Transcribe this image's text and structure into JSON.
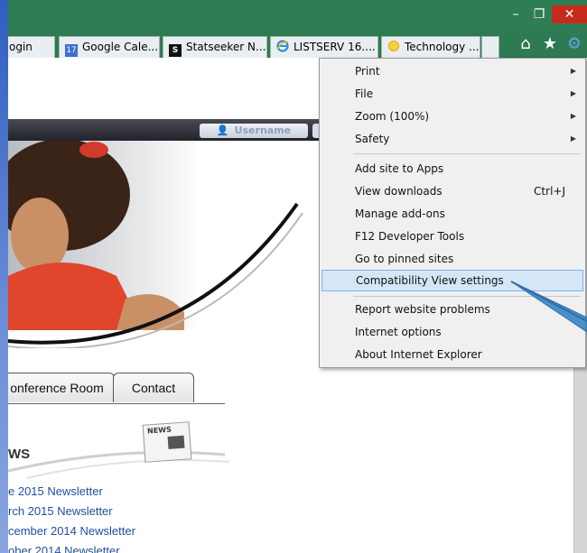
{
  "window": {
    "minimize_glyph": "–",
    "restore_glyph": "❐",
    "close_glyph": "✕"
  },
  "tabs": [
    {
      "label": "ogin",
      "icon": "none"
    },
    {
      "label": "Google Cale...",
      "icon": "calendar-icon",
      "badge": "17"
    },
    {
      "label": "Statseeker N...",
      "icon": "statseeker-icon",
      "badge": "S"
    },
    {
      "label": "LISTSERV 16....",
      "icon": "ie-icon"
    },
    {
      "label": "Technology ...",
      "icon": "sun-icon"
    }
  ],
  "toolbar": {
    "home_icon": "⌂",
    "favorites_icon": "★",
    "tools_icon": "⚙"
  },
  "page": {
    "username_label": "Username",
    "tabs": [
      "onference Room",
      "Contact"
    ],
    "news_heading": "WS",
    "news_badge": "NEWS",
    "news_links": [
      "e 2015 Newsletter",
      "rch 2015 Newsletter",
      "cember 2014 Newsletter",
      "ober 2014 Newsletter"
    ]
  },
  "menu": {
    "items": [
      {
        "label": "Print",
        "submenu": true
      },
      {
        "label": "File",
        "submenu": true
      },
      {
        "label": "Zoom (100%)",
        "submenu": true
      },
      {
        "label": "Safety",
        "submenu": true
      },
      {
        "label": "Add site to Apps"
      },
      {
        "label": "View downloads",
        "shortcut": "Ctrl+J"
      },
      {
        "label": "Manage add-ons"
      },
      {
        "label": "F12 Developer Tools"
      },
      {
        "label": "Go to pinned sites"
      },
      {
        "label": "Compatibility View settings",
        "highlighted": true
      },
      {
        "label": "Report website problems"
      },
      {
        "label": "Internet options"
      },
      {
        "label": "About Internet Explorer"
      }
    ],
    "submenu_glyph": "▶"
  },
  "colors": {
    "titlebar": "#2f7d55",
    "close": "#c42b1c",
    "menu_highlight": "#d5e6f7",
    "link": "#1f4e9e",
    "pointer_arrow": "#4a90c8"
  }
}
